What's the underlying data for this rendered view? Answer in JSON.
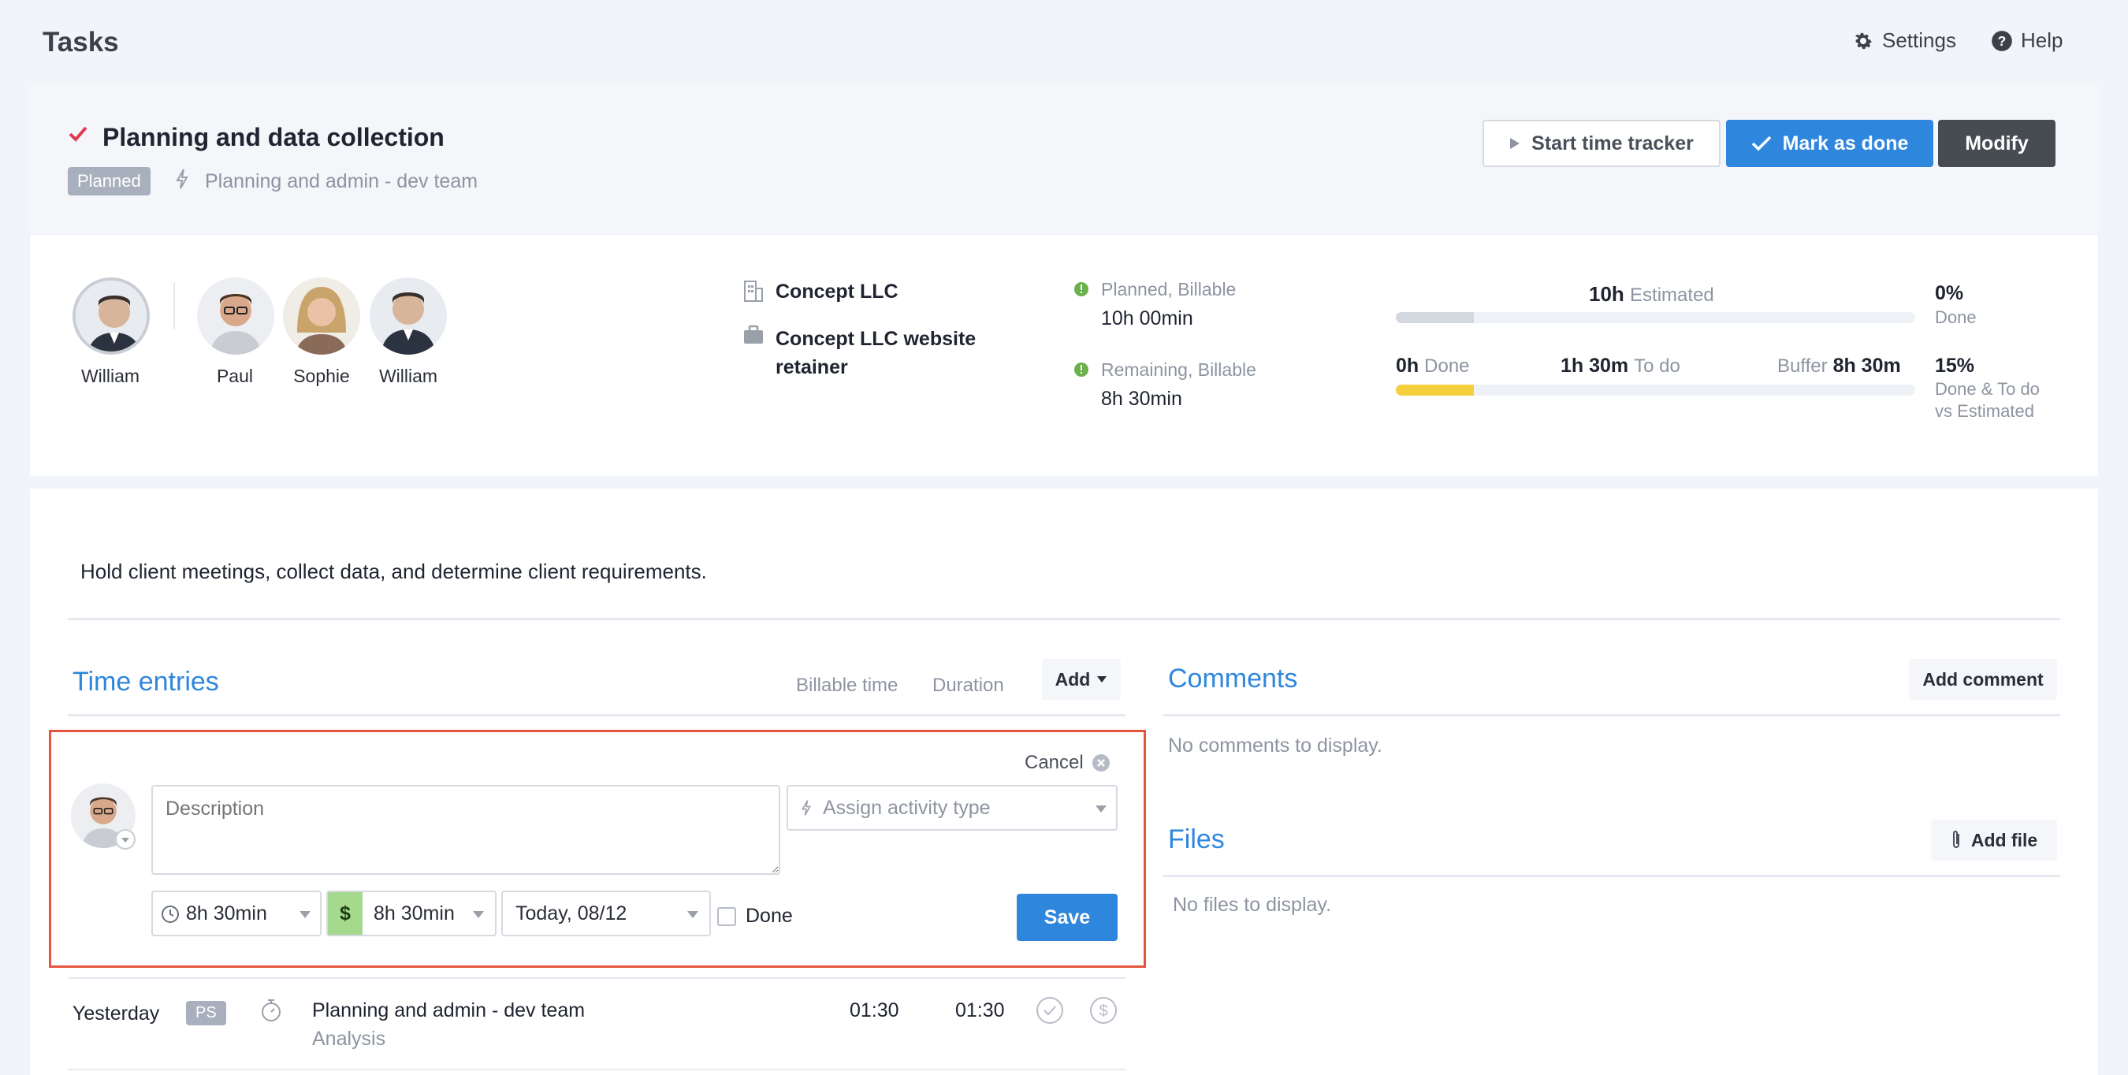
{
  "header": {
    "title": "Tasks",
    "settings_label": "Settings",
    "help_label": "Help"
  },
  "task": {
    "title": "Planning and data collection",
    "status_badge": "Planned",
    "activity": "Planning and admin - dev team",
    "actions": {
      "start_tracker": "Start time tracker",
      "mark_done": "Mark as done",
      "modify": "Modify"
    }
  },
  "people": {
    "owner": "William",
    "assignees": [
      "Paul",
      "Sophie",
      "William"
    ]
  },
  "client": {
    "company": "Concept LLC",
    "project_line1": "Concept LLC website",
    "project_line2": "retainer"
  },
  "budget": {
    "planned_label": "Planned, Billable",
    "planned_value": "10h 00min",
    "remaining_label": "Remaining, Billable",
    "remaining_value": "8h 30min"
  },
  "progress": {
    "estimated_value": "10h",
    "estimated_label": "Estimated",
    "top_fraction": 0.15,
    "done_value": "0h",
    "done_label": "Done",
    "todo_value": "1h 30m",
    "todo_label": "To do",
    "buffer_label": "Buffer",
    "buffer_value": "8h 30m",
    "bottom_fraction": 0.15,
    "pct_done": "0%",
    "pct_done_label": "Done",
    "pct_total": "15%",
    "pct_total_label1": "Done & To do",
    "pct_total_label2": "vs Estimated"
  },
  "description": "Hold client meetings, collect data, and determine client requirements.",
  "time_entries": {
    "title": "Time entries",
    "col_billable": "Billable time",
    "col_duration": "Duration",
    "add_label": "Add",
    "form": {
      "cancel_label": "Cancel",
      "description_placeholder": "Description",
      "activity_placeholder": "Assign activity type",
      "duration": "8h 30min",
      "billable_symbol": "$",
      "billable_duration": "8h 30min",
      "date": "Today, 08/12",
      "done_label": "Done",
      "save_label": "Save"
    },
    "rows": [
      {
        "date": "Yesterday",
        "badge": "PS",
        "title": "Planning and admin - dev team",
        "subtitle": "Analysis",
        "billable": "01:30",
        "duration": "01:30"
      }
    ]
  },
  "comments": {
    "title": "Comments",
    "add_label": "Add comment",
    "empty": "No comments to display."
  },
  "files": {
    "title": "Files",
    "add_label": "Add file",
    "empty": "No files to display."
  },
  "colors": {
    "accent": "#2f86dd",
    "highlight_border": "#e5553e",
    "done_bar": "#f5cf3c",
    "estimated_bar": "#d3d7de",
    "green_dot": "#6ab04c",
    "red_check": "#e03b4e"
  }
}
